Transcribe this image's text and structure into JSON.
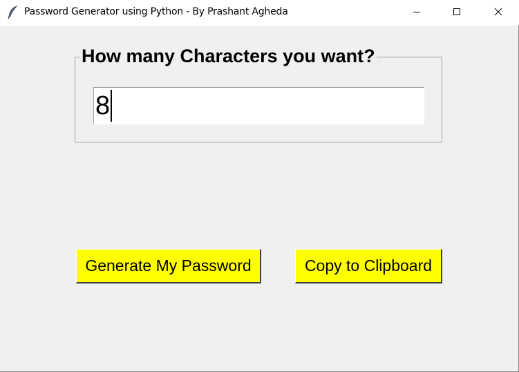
{
  "window": {
    "title": "Password Generator using Python - By Prashant Agheda",
    "app_icon": "feather-icon",
    "controls": {
      "minimize_icon": "minimize-icon",
      "maximize_icon": "maximize-icon",
      "close_icon": "close-icon"
    }
  },
  "form": {
    "group_label": "How many Characters you want?",
    "length_value": "8"
  },
  "buttons": {
    "generate_label": "Generate My Password",
    "copy_label": "Copy to Clipboard"
  },
  "colors": {
    "button_bg": "#ffff00",
    "window_bg": "#f0f0f0"
  }
}
